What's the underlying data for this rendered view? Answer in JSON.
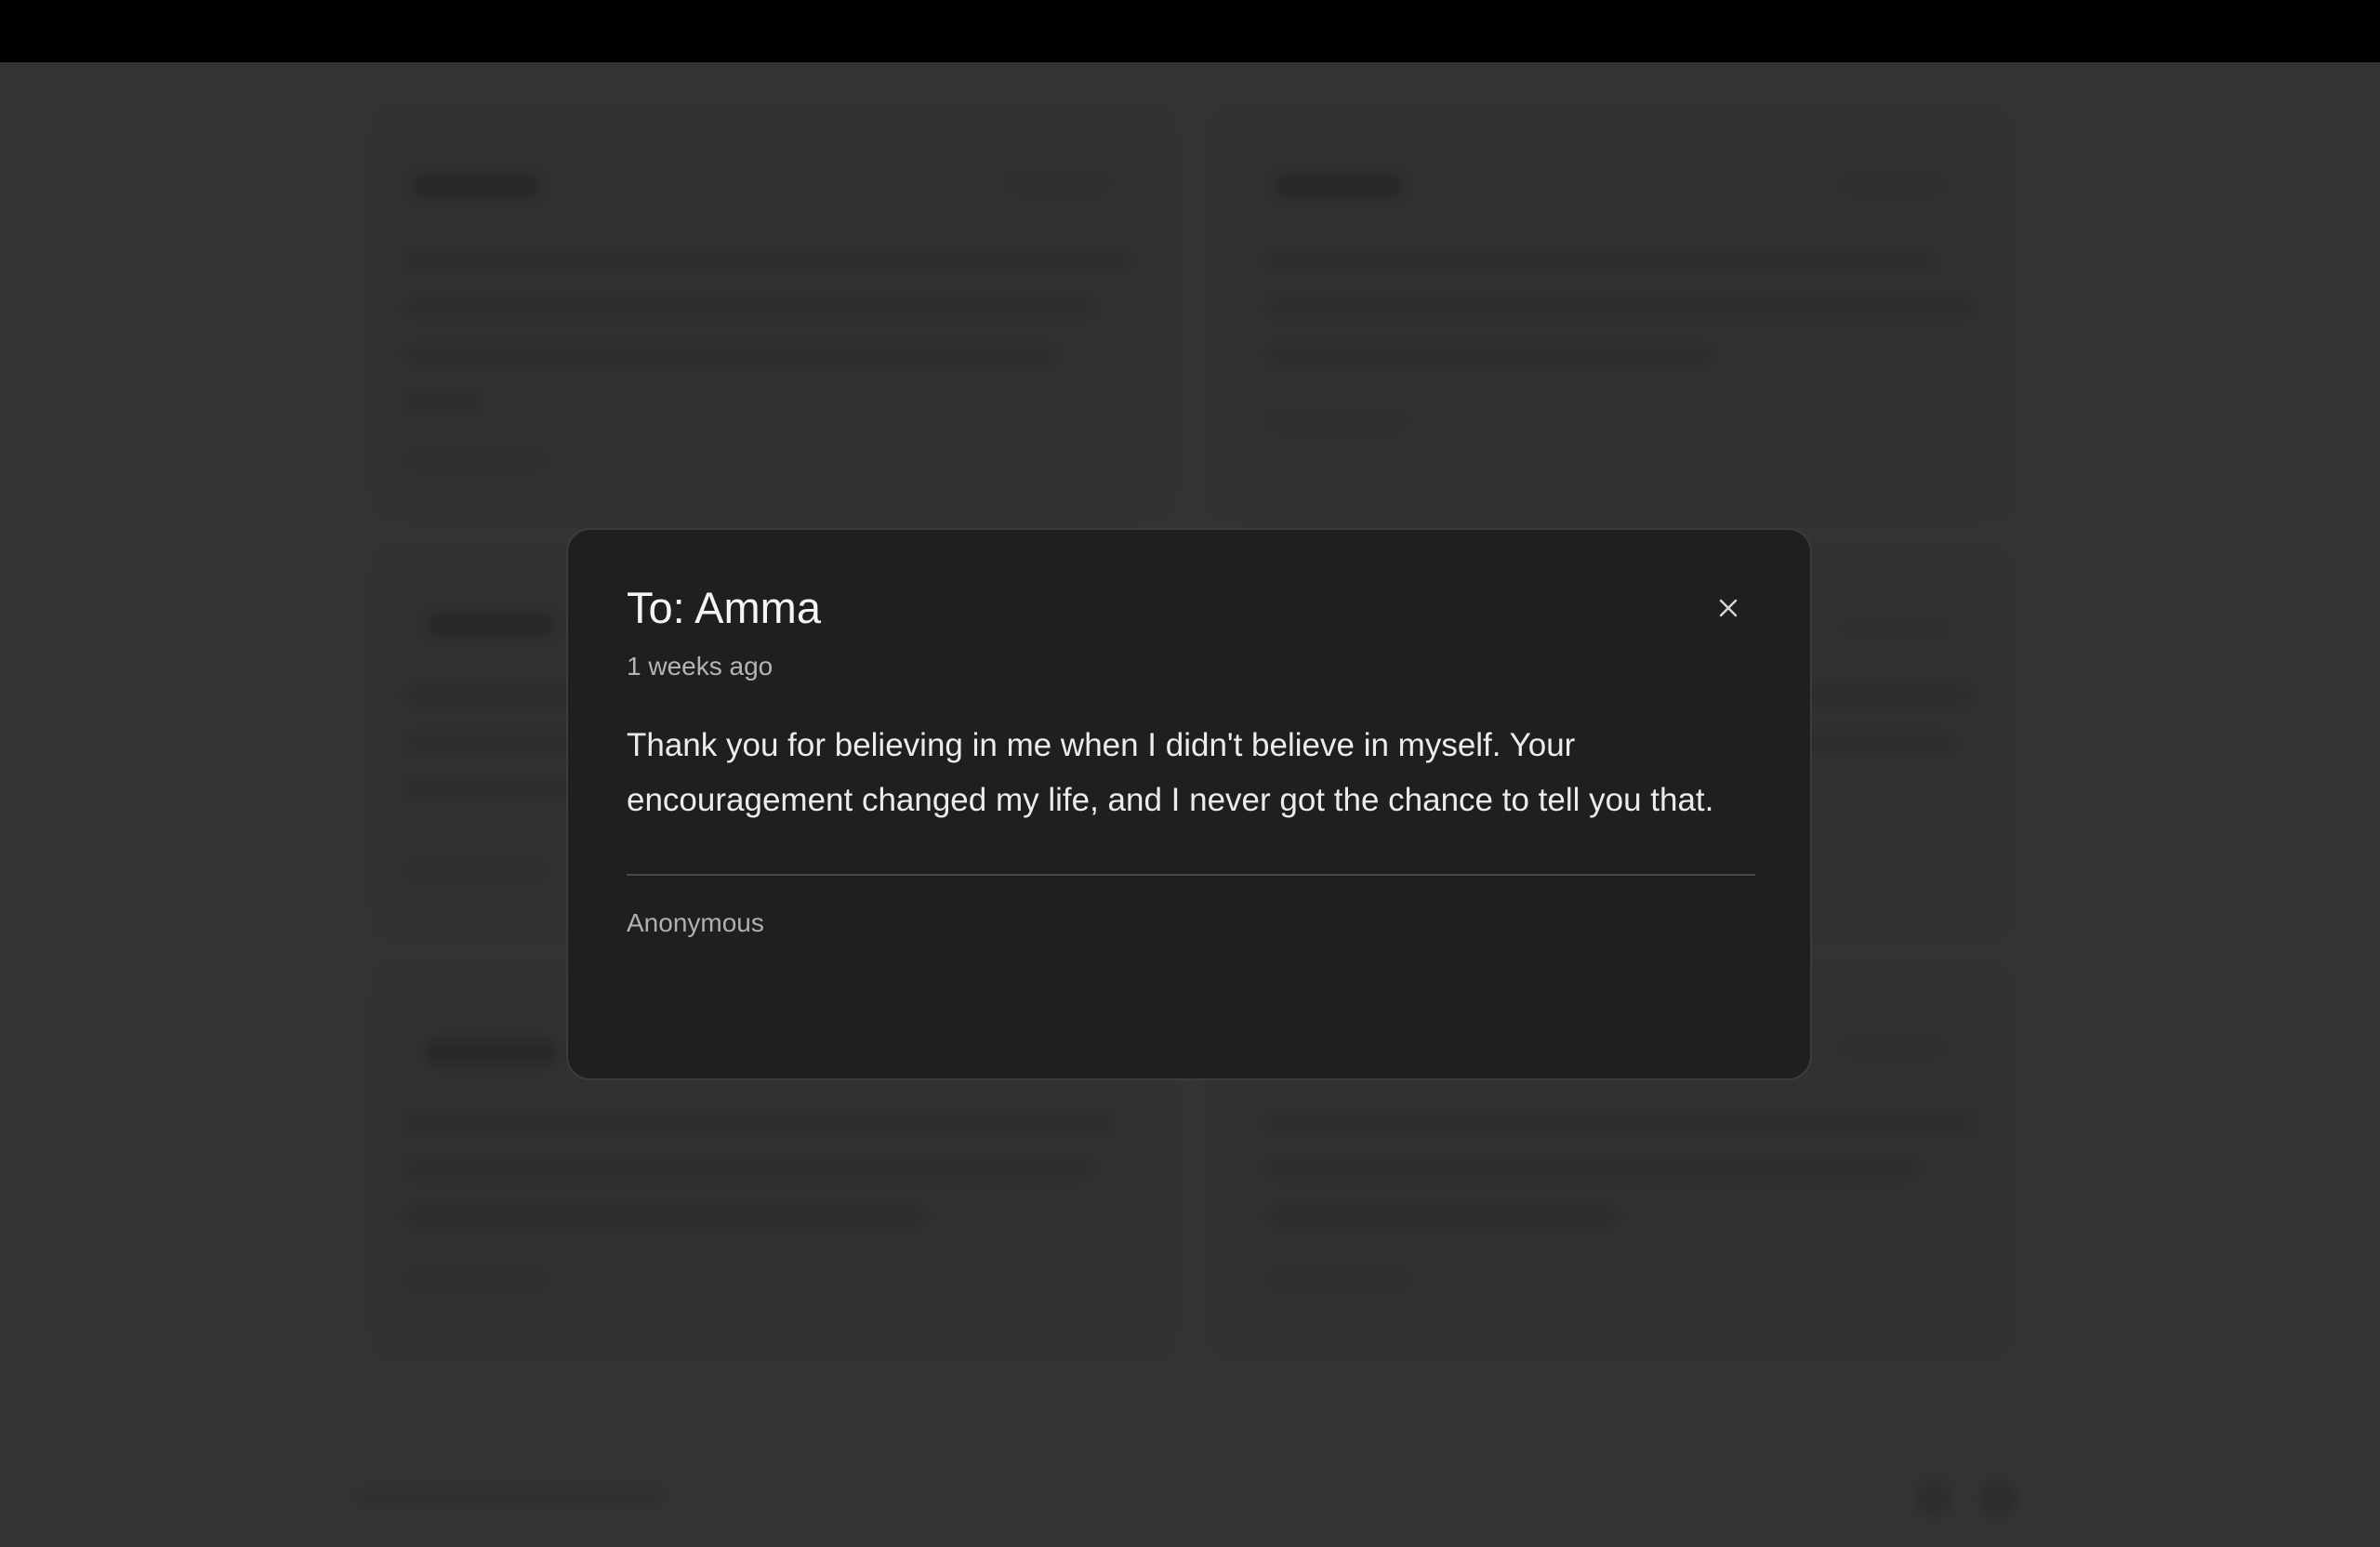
{
  "modal": {
    "title": "To: Amma",
    "time_ago": "1 weeks ago",
    "message": "Thank you for believing in me when I didn't believe in myself. Your encouragement changed my life, and I never got the chance to tell you that.",
    "author": "Anonymous",
    "close_icon": "close-icon"
  },
  "colors": {
    "backdrop": "#343434",
    "modal_background": "#1f1f1f",
    "modal_border": "#3c3c3c",
    "text_primary": "#f5f5f5",
    "text_secondary": "#b5b5b5"
  }
}
